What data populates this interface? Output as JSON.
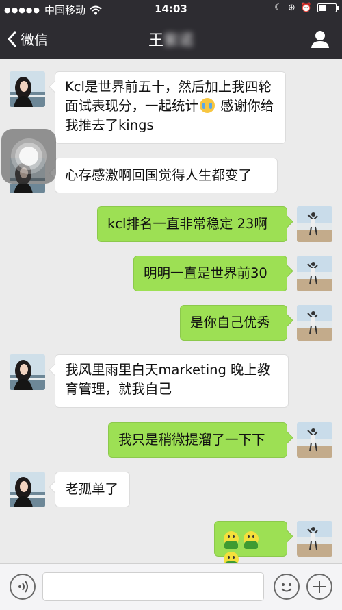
{
  "status_bar": {
    "carrier": "中国移动",
    "time": "14:03",
    "battery_level": 0.45
  },
  "nav": {
    "back_label": "微信",
    "title_prefix": "王",
    "title_blurred": "紫诺"
  },
  "messages": [
    {
      "side": "in",
      "text_part1": "Kcl是世界前五十，然后加上我四轮面试表现分，一起统计",
      "emoji": "crying-face",
      "text_part2": " 感谢你给我推去了kings"
    },
    {
      "side": "in",
      "text": "心存感激啊回国觉得人生都变了"
    },
    {
      "side": "out",
      "text": "kcl排名一直非常稳定 23啊"
    },
    {
      "side": "out",
      "text": "明明一直是世界前30"
    },
    {
      "side": "out",
      "text": "是你自己优秀"
    },
    {
      "side": "in",
      "text": "我风里雨里白天marketing 晚上教育管理，就我自己"
    },
    {
      "side": "out",
      "text": "我只是稍微提溜了一下下"
    },
    {
      "side": "in",
      "text": "老孤单了"
    },
    {
      "side": "out",
      "emoji": "three-smiley-sticker-emojis"
    }
  ],
  "input": {
    "value": "",
    "voice_icon": "voice-icon",
    "emoji_icon": "emoji-icon",
    "more_icon": "plus-icon"
  },
  "colors": {
    "nav_bg": "#2d2c31",
    "chat_bg": "#ebebeb",
    "sent_bubble": "#9de054",
    "received_bubble": "#ffffff"
  }
}
